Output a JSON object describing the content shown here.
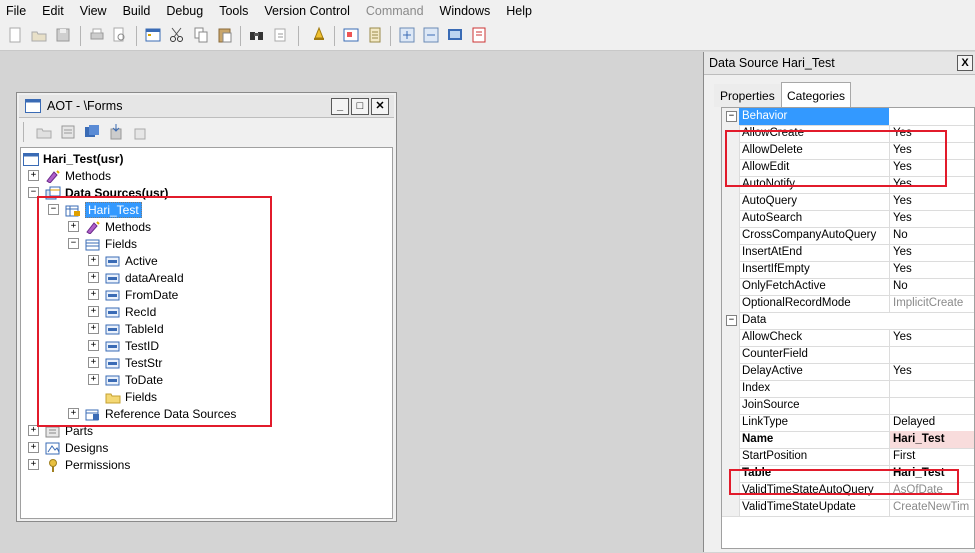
{
  "menu": [
    "File",
    "Edit",
    "View",
    "Build",
    "Debug",
    "Tools",
    "Version Control",
    "Command",
    "Windows",
    "Help"
  ],
  "aot": {
    "title": "AOT - \\Forms",
    "tree": [
      {
        "label": "Hari_Test(usr)",
        "bold": true,
        "exp": "",
        "icon": "form-icon"
      },
      {
        "label": "Methods",
        "exp": "+",
        "icon": "methods-icon"
      },
      {
        "label": "Data Sources(usr)",
        "bold": true,
        "exp": "−",
        "icon": "datasources-icon"
      },
      {
        "label": "Hari_Test",
        "exp": "−",
        "icon": "datasource-icon",
        "selected": true
      },
      {
        "label": "Methods",
        "exp": "+",
        "icon": "methods-icon"
      },
      {
        "label": "Fields",
        "exp": "−",
        "icon": "fields-icon"
      },
      {
        "label": "Active",
        "exp": "+",
        "icon": "field-icon"
      },
      {
        "label": "dataAreaId",
        "exp": "+",
        "icon": "field-icon"
      },
      {
        "label": "FromDate",
        "exp": "+",
        "icon": "field-icon"
      },
      {
        "label": "RecId",
        "exp": "+",
        "icon": "field-icon"
      },
      {
        "label": "TableId",
        "exp": "+",
        "icon": "field-icon"
      },
      {
        "label": "TestID",
        "exp": "+",
        "icon": "field-icon"
      },
      {
        "label": "TestStr",
        "exp": "+",
        "icon": "field-icon"
      },
      {
        "label": "ToDate",
        "exp": "+",
        "icon": "field-icon"
      },
      {
        "label": "Fields",
        "exp": "",
        "icon": "folder-icon"
      },
      {
        "label": "Reference Data Sources",
        "exp": "+",
        "icon": "reference-icon"
      },
      {
        "label": "Parts",
        "exp": "+",
        "icon": "parts-icon"
      },
      {
        "label": "Designs",
        "exp": "+",
        "icon": "designs-icon"
      },
      {
        "label": "Permissions",
        "exp": "+",
        "icon": "permissions-icon"
      }
    ]
  },
  "props": {
    "title": "Data Source Hari_Test",
    "close": "X",
    "tabs": [
      "Properties",
      "Categories"
    ],
    "rows": [
      {
        "category": "Behavior",
        "selected": true
      },
      {
        "name": "AllowCreate",
        "value": "Yes"
      },
      {
        "name": "AllowDelete",
        "value": "Yes"
      },
      {
        "name": "AllowEdit",
        "value": "Yes"
      },
      {
        "name": "AutoNotify",
        "value": "Yes"
      },
      {
        "name": "AutoQuery",
        "value": "Yes"
      },
      {
        "name": "AutoSearch",
        "value": "Yes"
      },
      {
        "name": "CrossCompanyAutoQuery",
        "value": "No"
      },
      {
        "name": "InsertAtEnd",
        "value": "Yes"
      },
      {
        "name": "InsertIfEmpty",
        "value": "Yes"
      },
      {
        "name": "OnlyFetchActive",
        "value": "No"
      },
      {
        "name": "OptionalRecordMode",
        "value": "ImplicitCreate",
        "gray": true
      },
      {
        "category": "Data"
      },
      {
        "name": "AllowCheck",
        "value": "Yes"
      },
      {
        "name": "CounterField",
        "value": ""
      },
      {
        "name": "DelayActive",
        "value": "Yes"
      },
      {
        "name": "Index",
        "value": ""
      },
      {
        "name": "JoinSource",
        "value": ""
      },
      {
        "name": "LinkType",
        "value": "Delayed"
      },
      {
        "name": "Name",
        "value": "Hari_Test",
        "bold": true,
        "pink": true
      },
      {
        "name": "StartPosition",
        "value": "First"
      },
      {
        "name": "Table",
        "value": "Hari_Test",
        "bold": true
      },
      {
        "name": "ValidTimeStateAutoQuery",
        "value": "AsOfDate",
        "gray": true
      },
      {
        "name": "ValidTimeStateUpdate",
        "value": "CreateNewTim",
        "gray": true
      }
    ]
  },
  "colors": {
    "highlight": "#e21b2b",
    "selection": "#3399ff"
  }
}
